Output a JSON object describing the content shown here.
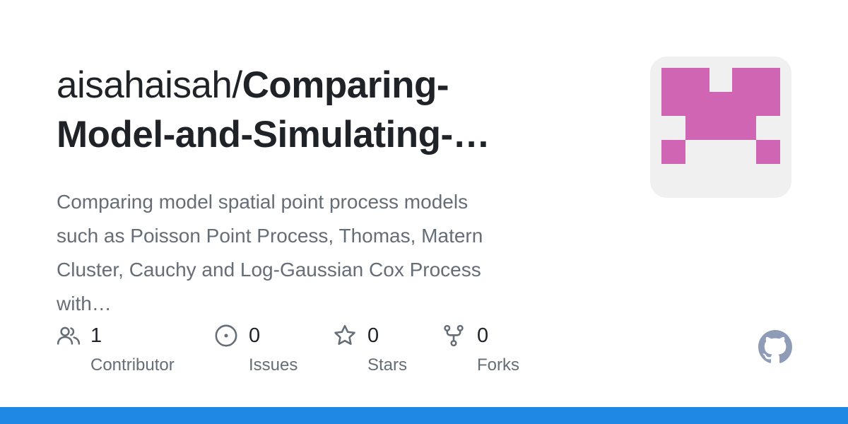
{
  "repo": {
    "owner_prefix": "aisahaisah/",
    "name_line1": "Comparing-",
    "name_line2": "Model-and-Simulating-…"
  },
  "description": {
    "line1": "Comparing model spatial point process models",
    "line2": "such as Poisson Point Process, Thomas, Matern",
    "line3": "Cluster, Cauchy and Log-Gaussian Cox Process",
    "line4": "with…"
  },
  "stats": {
    "contributors": {
      "count": "1",
      "label": "Contributor",
      "icon": "people-icon"
    },
    "issues": {
      "count": "0",
      "label": "Issues",
      "icon": "issue-opened-icon"
    },
    "stars": {
      "count": "0",
      "label": "Stars",
      "icon": "star-icon"
    },
    "forks": {
      "count": "0",
      "label": "Forks",
      "icon": "repo-forked-icon"
    }
  },
  "avatar": {
    "icon": "identicon",
    "color": "#d065b4",
    "background": "#f0f0f0"
  },
  "brand": {
    "icon": "github-mark-icon",
    "color": "#8e9cb8"
  },
  "accent_bar_color": "#1f88e5"
}
